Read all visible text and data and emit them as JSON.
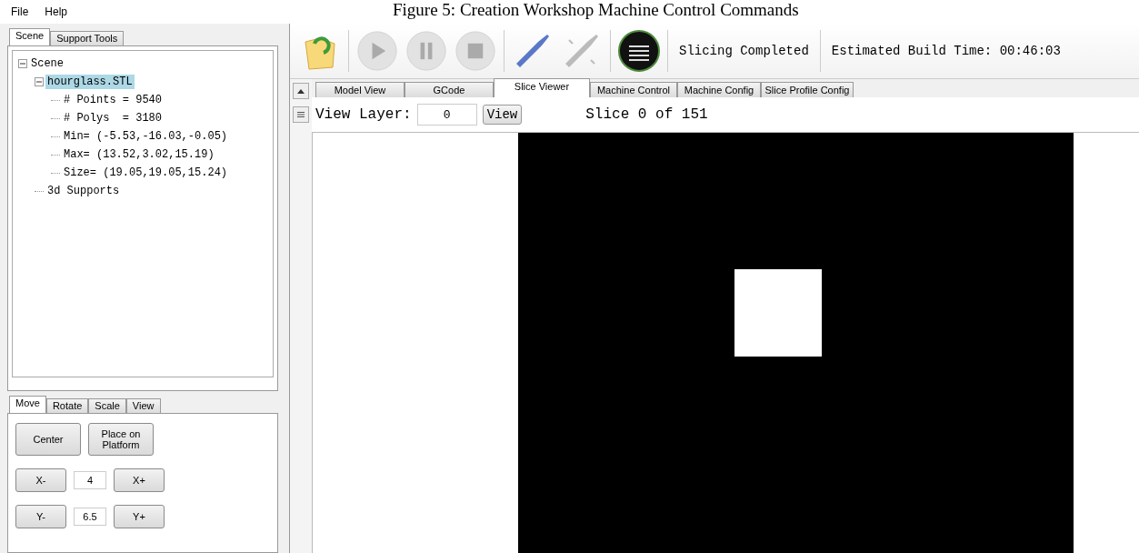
{
  "caption": "Figure 5: Creation Workshop Machine Control Commands",
  "menu": [
    "File",
    "Help"
  ],
  "left_tabs": [
    {
      "label": "Scene",
      "selected": true
    },
    {
      "label": "Support Tools",
      "selected": false
    }
  ],
  "tree": [
    {
      "label": "Scene",
      "expanded": true,
      "selected": false,
      "children": [
        {
          "label": "hourglass.STL",
          "expanded": true,
          "selected": true,
          "children": [
            {
              "label": "# Points = 9540"
            },
            {
              "label": "# Polys  = 3180"
            },
            {
              "label": "Min= (-5.53,-16.03,-0.05)"
            },
            {
              "label": "Max= (13.52,3.02,15.19)"
            },
            {
              "label": "Size= (19.05,19.05,15.24)"
            }
          ]
        },
        {
          "label": "3d Supports"
        }
      ]
    }
  ],
  "transform_tabs": [
    {
      "label": "Move",
      "selected": true
    },
    {
      "label": "Rotate",
      "selected": false
    },
    {
      "label": "Scale",
      "selected": false
    },
    {
      "label": "View",
      "selected": false
    }
  ],
  "move": {
    "buttons": [
      "Center",
      "Place on Platform"
    ],
    "axes": [
      {
        "minus": "X-",
        "value": "4",
        "plus": "X+"
      },
      {
        "minus": "Y-",
        "value": "6.5",
        "plus": "Y+"
      }
    ]
  },
  "toolbar": {
    "tools": [
      {
        "kind": "open",
        "disabled": false
      },
      {
        "kind": "play",
        "disabled": true
      },
      {
        "kind": "pause",
        "disabled": true
      },
      {
        "kind": "stop",
        "disabled": true
      },
      {
        "kind": "connect",
        "disabled": false
      },
      {
        "kind": "disconnect",
        "disabled": true
      },
      {
        "kind": "slice",
        "disabled": false
      }
    ],
    "status": "Slicing Completed",
    "build_time": "Estimated Build Time: 00:46:03"
  },
  "tabs": [
    {
      "label": "Model View",
      "selected": false
    },
    {
      "label": "GCode",
      "selected": false
    },
    {
      "label": "Slice Viewer",
      "selected": true
    },
    {
      "label": "Machine Control",
      "selected": false
    },
    {
      "label": "Machine Config",
      "selected": false
    },
    {
      "label": "Slice Profile Config",
      "selected": false
    }
  ],
  "slice_viewer": {
    "layer_label": "View Layer:",
    "layer_value": "0",
    "view_button": "View",
    "slice_info": "Slice 0 of 151"
  }
}
